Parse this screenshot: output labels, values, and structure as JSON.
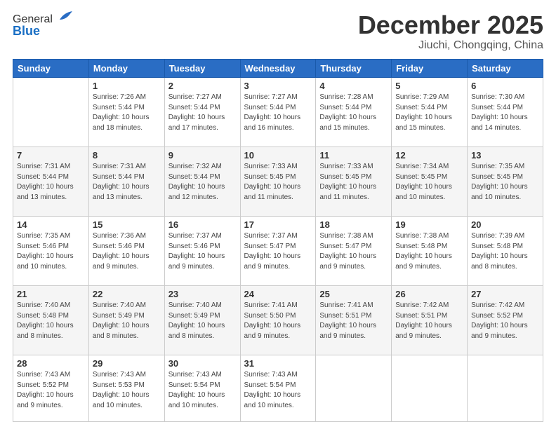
{
  "header": {
    "logo_line1": "General",
    "logo_line2": "Blue",
    "month": "December 2025",
    "location": "Jiuchi, Chongqing, China"
  },
  "days_of_week": [
    "Sunday",
    "Monday",
    "Tuesday",
    "Wednesday",
    "Thursday",
    "Friday",
    "Saturday"
  ],
  "weeks": [
    [
      {
        "day": "",
        "info": ""
      },
      {
        "day": "1",
        "info": "Sunrise: 7:26 AM\nSunset: 5:44 PM\nDaylight: 10 hours\nand 18 minutes."
      },
      {
        "day": "2",
        "info": "Sunrise: 7:27 AM\nSunset: 5:44 PM\nDaylight: 10 hours\nand 17 minutes."
      },
      {
        "day": "3",
        "info": "Sunrise: 7:27 AM\nSunset: 5:44 PM\nDaylight: 10 hours\nand 16 minutes."
      },
      {
        "day": "4",
        "info": "Sunrise: 7:28 AM\nSunset: 5:44 PM\nDaylight: 10 hours\nand 15 minutes."
      },
      {
        "day": "5",
        "info": "Sunrise: 7:29 AM\nSunset: 5:44 PM\nDaylight: 10 hours\nand 15 minutes."
      },
      {
        "day": "6",
        "info": "Sunrise: 7:30 AM\nSunset: 5:44 PM\nDaylight: 10 hours\nand 14 minutes."
      }
    ],
    [
      {
        "day": "7",
        "info": "Sunrise: 7:31 AM\nSunset: 5:44 PM\nDaylight: 10 hours\nand 13 minutes."
      },
      {
        "day": "8",
        "info": "Sunrise: 7:31 AM\nSunset: 5:44 PM\nDaylight: 10 hours\nand 13 minutes."
      },
      {
        "day": "9",
        "info": "Sunrise: 7:32 AM\nSunset: 5:44 PM\nDaylight: 10 hours\nand 12 minutes."
      },
      {
        "day": "10",
        "info": "Sunrise: 7:33 AM\nSunset: 5:45 PM\nDaylight: 10 hours\nand 11 minutes."
      },
      {
        "day": "11",
        "info": "Sunrise: 7:33 AM\nSunset: 5:45 PM\nDaylight: 10 hours\nand 11 minutes."
      },
      {
        "day": "12",
        "info": "Sunrise: 7:34 AM\nSunset: 5:45 PM\nDaylight: 10 hours\nand 10 minutes."
      },
      {
        "day": "13",
        "info": "Sunrise: 7:35 AM\nSunset: 5:45 PM\nDaylight: 10 hours\nand 10 minutes."
      }
    ],
    [
      {
        "day": "14",
        "info": "Sunrise: 7:35 AM\nSunset: 5:46 PM\nDaylight: 10 hours\nand 10 minutes."
      },
      {
        "day": "15",
        "info": "Sunrise: 7:36 AM\nSunset: 5:46 PM\nDaylight: 10 hours\nand 9 minutes."
      },
      {
        "day": "16",
        "info": "Sunrise: 7:37 AM\nSunset: 5:46 PM\nDaylight: 10 hours\nand 9 minutes."
      },
      {
        "day": "17",
        "info": "Sunrise: 7:37 AM\nSunset: 5:47 PM\nDaylight: 10 hours\nand 9 minutes."
      },
      {
        "day": "18",
        "info": "Sunrise: 7:38 AM\nSunset: 5:47 PM\nDaylight: 10 hours\nand 9 minutes."
      },
      {
        "day": "19",
        "info": "Sunrise: 7:38 AM\nSunset: 5:48 PM\nDaylight: 10 hours\nand 9 minutes."
      },
      {
        "day": "20",
        "info": "Sunrise: 7:39 AM\nSunset: 5:48 PM\nDaylight: 10 hours\nand 8 minutes."
      }
    ],
    [
      {
        "day": "21",
        "info": "Sunrise: 7:40 AM\nSunset: 5:48 PM\nDaylight: 10 hours\nand 8 minutes."
      },
      {
        "day": "22",
        "info": "Sunrise: 7:40 AM\nSunset: 5:49 PM\nDaylight: 10 hours\nand 8 minutes."
      },
      {
        "day": "23",
        "info": "Sunrise: 7:40 AM\nSunset: 5:49 PM\nDaylight: 10 hours\nand 8 minutes."
      },
      {
        "day": "24",
        "info": "Sunrise: 7:41 AM\nSunset: 5:50 PM\nDaylight: 10 hours\nand 9 minutes."
      },
      {
        "day": "25",
        "info": "Sunrise: 7:41 AM\nSunset: 5:51 PM\nDaylight: 10 hours\nand 9 minutes."
      },
      {
        "day": "26",
        "info": "Sunrise: 7:42 AM\nSunset: 5:51 PM\nDaylight: 10 hours\nand 9 minutes."
      },
      {
        "day": "27",
        "info": "Sunrise: 7:42 AM\nSunset: 5:52 PM\nDaylight: 10 hours\nand 9 minutes."
      }
    ],
    [
      {
        "day": "28",
        "info": "Sunrise: 7:43 AM\nSunset: 5:52 PM\nDaylight: 10 hours\nand 9 minutes."
      },
      {
        "day": "29",
        "info": "Sunrise: 7:43 AM\nSunset: 5:53 PM\nDaylight: 10 hours\nand 10 minutes."
      },
      {
        "day": "30",
        "info": "Sunrise: 7:43 AM\nSunset: 5:54 PM\nDaylight: 10 hours\nand 10 minutes."
      },
      {
        "day": "31",
        "info": "Sunrise: 7:43 AM\nSunset: 5:54 PM\nDaylight: 10 hours\nand 10 minutes."
      },
      {
        "day": "",
        "info": ""
      },
      {
        "day": "",
        "info": ""
      },
      {
        "day": "",
        "info": ""
      }
    ]
  ]
}
